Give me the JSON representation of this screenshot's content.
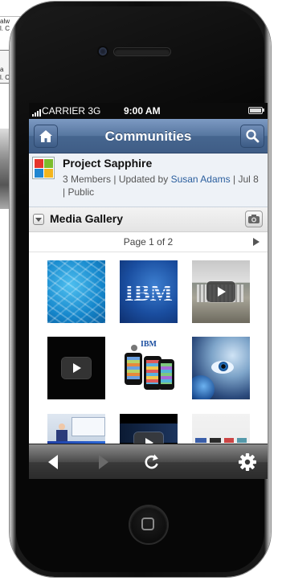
{
  "background_doc": {
    "lines": [
      "alw",
      "l. C",
      "a",
      "l. C"
    ]
  },
  "status_bar": {
    "carrier": "CARRIER 3G",
    "time": "9:00 AM"
  },
  "nav": {
    "title": "Communities",
    "home_icon": "home-icon",
    "search_icon": "search-icon"
  },
  "community": {
    "name": "Project Sapphire",
    "members": "3 Members",
    "updated_prefix": "Updated by",
    "updated_by": "Susan Adams",
    "date": "Jul 8",
    "visibility": "Public",
    "sep": "|"
  },
  "gallery": {
    "title": "Media Gallery",
    "page_label": "Page 1 of 2",
    "items": [
      {
        "kind": "image",
        "subject": "water"
      },
      {
        "kind": "image",
        "subject": "ibm-logo"
      },
      {
        "kind": "video",
        "subject": "building"
      },
      {
        "kind": "video",
        "subject": "black"
      },
      {
        "kind": "image",
        "subject": "phones"
      },
      {
        "kind": "image",
        "subject": "eye"
      },
      {
        "kind": "image",
        "subject": "presentation"
      },
      {
        "kind": "video",
        "subject": "slide"
      },
      {
        "kind": "image",
        "subject": "logos"
      }
    ],
    "ibm_logo_text": "IBM",
    "phones_badge": "IBM"
  },
  "toolbar": {
    "back_icon": "back-arrow-icon",
    "forward_icon": "forward-arrow-icon",
    "reload_icon": "reload-icon",
    "settings_icon": "gear-icon"
  },
  "colors": {
    "nav_blue": "#4f6f99",
    "link": "#2a5e9e",
    "toolbar_dark": "#2b2b2b"
  }
}
